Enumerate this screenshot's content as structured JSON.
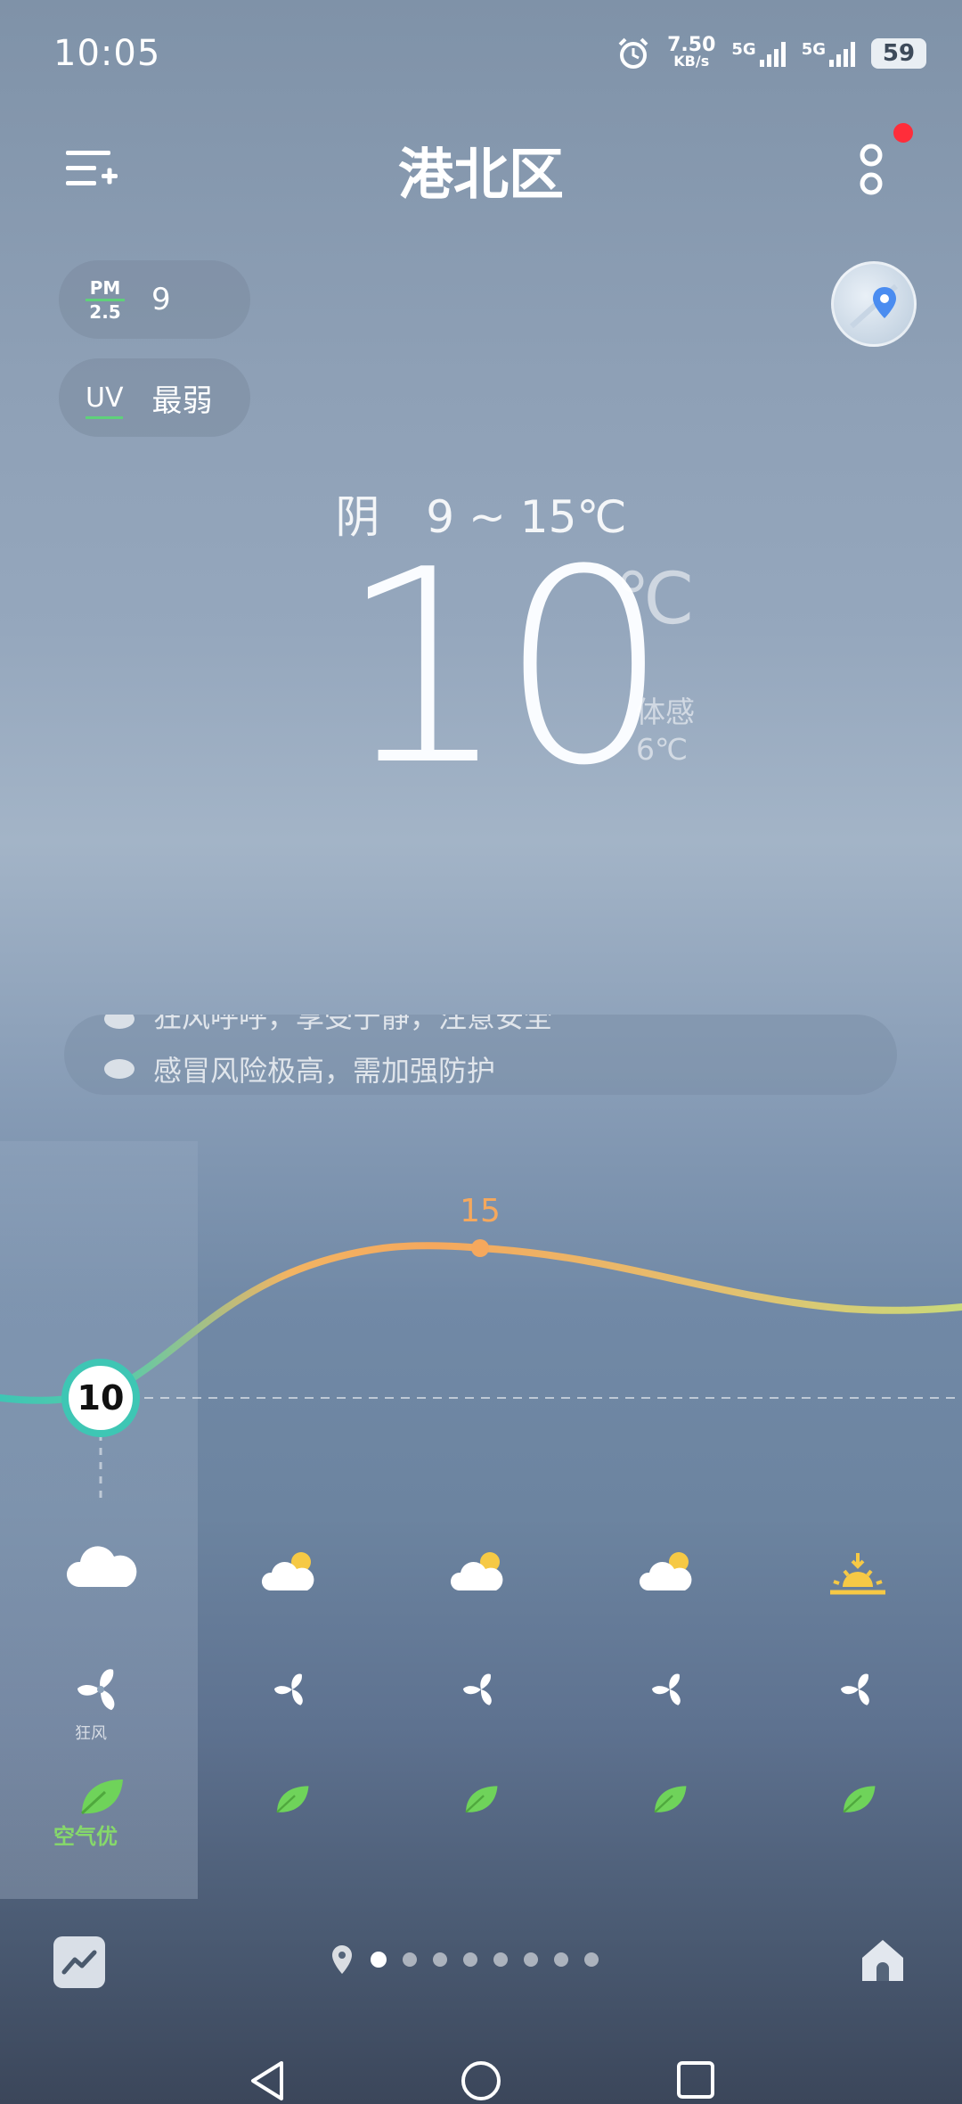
{
  "status_bar": {
    "time": "10:05",
    "speed_value": "7.50",
    "speed_unit": "KB/s",
    "net1": "5G",
    "net2": "5G",
    "battery": "59"
  },
  "header": {
    "city": "港北区"
  },
  "air": {
    "pm_top": "PM",
    "pm_bottom": "2.5",
    "pm_value": "9",
    "uv_label": "UV",
    "uv_value": "最弱"
  },
  "current": {
    "condition": "阴",
    "range": "9 ~ 15℃",
    "temp": "10",
    "unit": "℃",
    "feels_label": "体感",
    "feels_value": "6℃"
  },
  "tips": {
    "tip1": "狂风呼呼，享受宁静，注意安全",
    "tip2": "感冒风险极高，需加强防护"
  },
  "hourly": {
    "current_temp": "10",
    "peak_temp": "15",
    "wind_label": "狂风",
    "aqi_label": "空气优",
    "temps": [
      10,
      13,
      15,
      14.2,
      13
    ]
  },
  "pager": {
    "page_count": 8,
    "active_index": 0
  },
  "colors": {
    "accent_green": "#86d96a",
    "curve_start": "#3ec6b4",
    "curve_peak": "#f5a85d",
    "curve_end": "#c9d97a",
    "red_dot": "#ff2d3a"
  }
}
